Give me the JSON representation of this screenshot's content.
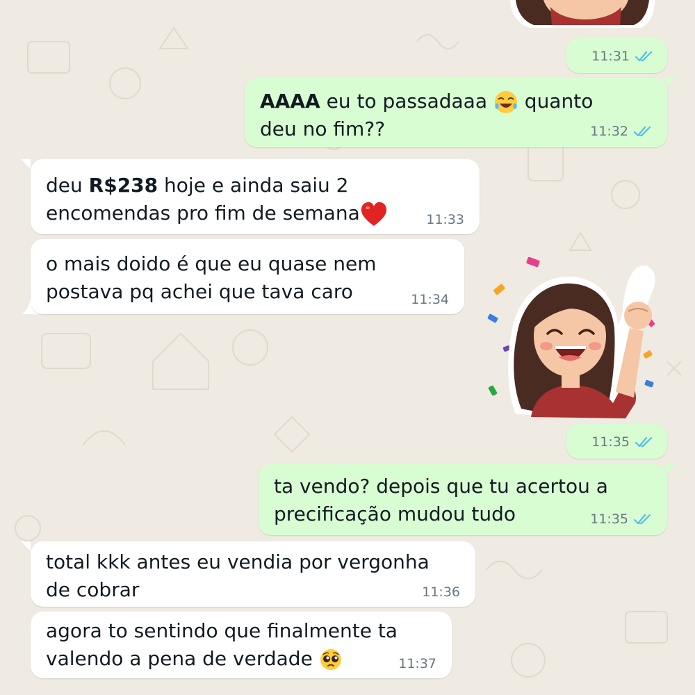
{
  "messages": [
    {
      "id": "m1",
      "direction": "out",
      "kind": "sticker-time",
      "time": "11:31",
      "status": "read"
    },
    {
      "id": "m2",
      "direction": "out",
      "line1_bold": "AAAA",
      "line1_rest": " eu to passadaaa ",
      "line1_emoji": "face-with-tears-of-joy",
      "line1_after": " quanto",
      "line2": "deu no fim??",
      "time": "11:32",
      "status": "read"
    },
    {
      "id": "m3",
      "direction": "in",
      "line1_pre": "deu ",
      "line1_bold": "R$238",
      "line1_rest": " hoje e ainda saiu 2",
      "line2": "encomendas pro fim de semana",
      "line2_emoji": "red-heart",
      "time": "11:33"
    },
    {
      "id": "m4",
      "direction": "in",
      "line1": "o mais doido é que eu quase nem",
      "line2": "postava pq achei que tava caro",
      "time": "11:34"
    },
    {
      "id": "m5",
      "direction": "out",
      "kind": "sticker",
      "sticker": "celebrating-girl-sticker",
      "time": "11:35",
      "status": "read"
    },
    {
      "id": "m6",
      "direction": "out",
      "line1": "ta vendo? depois que tu acertou a",
      "line2": "precificação mudou tudo",
      "time": "11:35",
      "status": "read"
    },
    {
      "id": "m7",
      "direction": "in",
      "line1": "total kkk antes eu vendia por vergonha",
      "line2": "de cobrar",
      "time": "11:36"
    },
    {
      "id": "m8",
      "direction": "in",
      "line1": "agora to sentindo que finalmente ta",
      "line2": "valendo a pena de verdade ",
      "line2_emoji": "pleading-face",
      "time": "11:37"
    }
  ],
  "colors": {
    "background": "#efeae2",
    "incoming_bubble": "#ffffff",
    "outgoing_bubble": "#d9fdd3",
    "read_ticks": "#53bdeb",
    "timestamp": "#667781",
    "text": "#111b21"
  }
}
